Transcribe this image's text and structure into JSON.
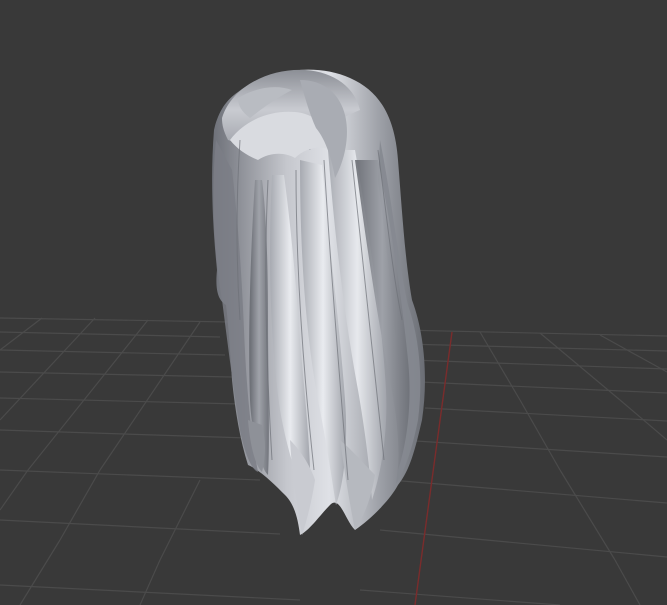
{
  "viewport": {
    "background": "#393939",
    "grid_color": "#4c4c4c",
    "grid_visible": true,
    "x_axis_visible": false,
    "y_axis_color": "#8a2f2f",
    "y_axis_visible": true
  },
  "model": {
    "object": "hair-mesh",
    "shading": "solid",
    "base_color": "#9c9fa6",
    "highlight_color": "#e6e8ed",
    "shadow_color": "#5b5e66"
  }
}
